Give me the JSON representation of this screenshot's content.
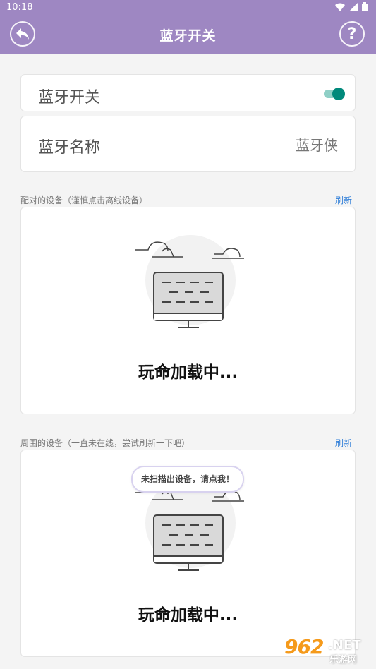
{
  "status_bar": {
    "time": "10:18"
  },
  "app_bar": {
    "title": "蓝牙开关"
  },
  "bluetooth_switch": {
    "label": "蓝牙开关",
    "enabled": true,
    "accent_color": "#00897b"
  },
  "bluetooth_name": {
    "label": "蓝牙名称",
    "value": "蓝牙侠"
  },
  "paired_section": {
    "label": "配对的设备（谨慎点击离线设备）",
    "refresh_label": "刷新",
    "loading_text": "玩命加载中..."
  },
  "nearby_section": {
    "label": "周围的设备（一直未在线，尝试刷新一下吧）",
    "refresh_label": "刷新",
    "loading_text": "玩命加载中...",
    "tooltip": "未扫描出设备，请点我！"
  },
  "watermark": {
    "logo": "962",
    "net": ".NET",
    "sub": "乐游网"
  },
  "colors": {
    "app_bar": "#9e87c2",
    "link": "#2f7ed8"
  }
}
